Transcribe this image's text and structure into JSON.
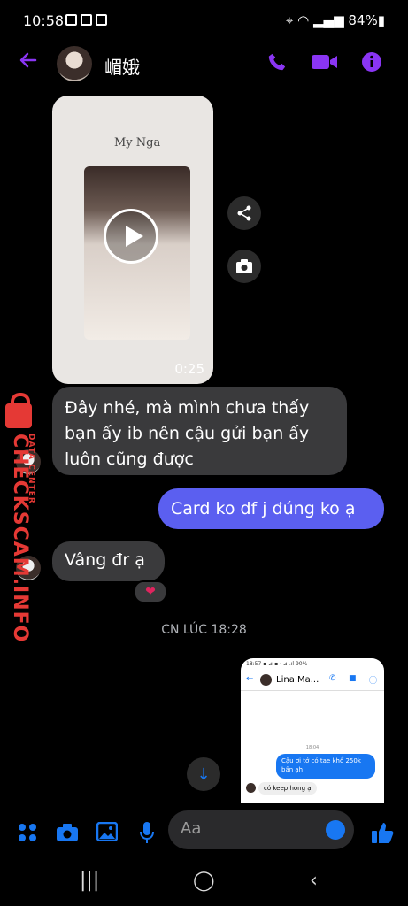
{
  "status_bar": {
    "time": "10:58",
    "battery": "84%"
  },
  "header": {
    "contact_name": "嵋娥"
  },
  "video_message": {
    "card_text": "My Nga",
    "duration": "0:25"
  },
  "messages": [
    {
      "direction": "in",
      "text": "Đây nhé, mà mình chưa thấy bạn ấy ib nên cậu gửi bạn ấy luôn cũng được"
    },
    {
      "direction": "out",
      "text": "Card ko df j đúng ko ạ"
    },
    {
      "direction": "in",
      "text": "Vâng đr ạ",
      "reaction": "❤"
    }
  ],
  "timestamp": "CN LÚC 18:28",
  "shared_screenshot": {
    "status": "18:57 ▪ ⊿ ▪ ·    ⊿ .ıl 90%",
    "contact": "Lina Ma...",
    "time": "18:04",
    "out_text": "Cậu ơi tớ có tae khổ 250k bấn ạh",
    "in_text": "có keep hong ạ"
  },
  "composer": {
    "placeholder": "Aa"
  },
  "watermark": {
    "brand": "CHECKSCAM.INFO",
    "sub": "DATA CENTER"
  },
  "colors": {
    "accent": "#8a35f3",
    "messenger_blue": "#1877f2",
    "outgoing": "#5b5ff0",
    "incoming": "#3a3a3c"
  }
}
